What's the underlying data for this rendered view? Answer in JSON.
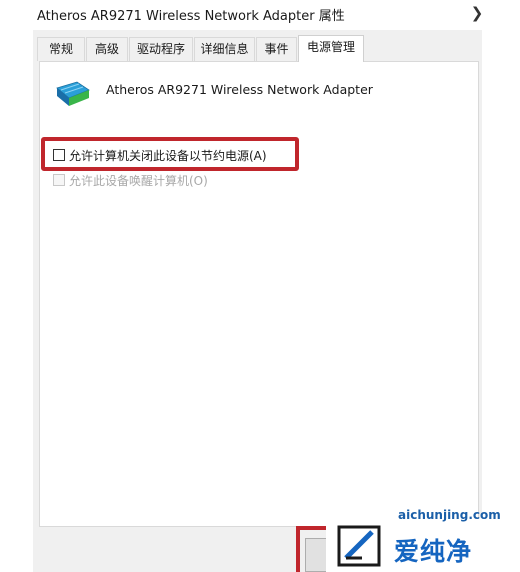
{
  "window": {
    "title": "Atheros AR9271 Wireless Network Adapter 属性",
    "close_icon": "close-icon"
  },
  "tabs": [
    {
      "label": "常规",
      "active": false
    },
    {
      "label": "高级",
      "active": false
    },
    {
      "label": "驱动程序",
      "active": false
    },
    {
      "label": "详细信息",
      "active": false
    },
    {
      "label": "事件",
      "active": false
    },
    {
      "label": "电源管理",
      "active": true
    }
  ],
  "device": {
    "icon": "network-adapter-icon",
    "name": "Atheros AR9271 Wireless Network Adapter"
  },
  "options": [
    {
      "label": "允许计算机关闭此设备以节约电源(A)",
      "checked": false,
      "enabled": true
    },
    {
      "label": "允许此设备唤醒计算机(O)",
      "checked": false,
      "enabled": false
    }
  ],
  "colors": {
    "highlight": "#c0262c",
    "watermark_blue": "#1565c0"
  },
  "watermark": {
    "url": "aichunjing.com",
    "title": "爱纯净",
    "logo_icon": "aichunjing-logo-icon"
  }
}
